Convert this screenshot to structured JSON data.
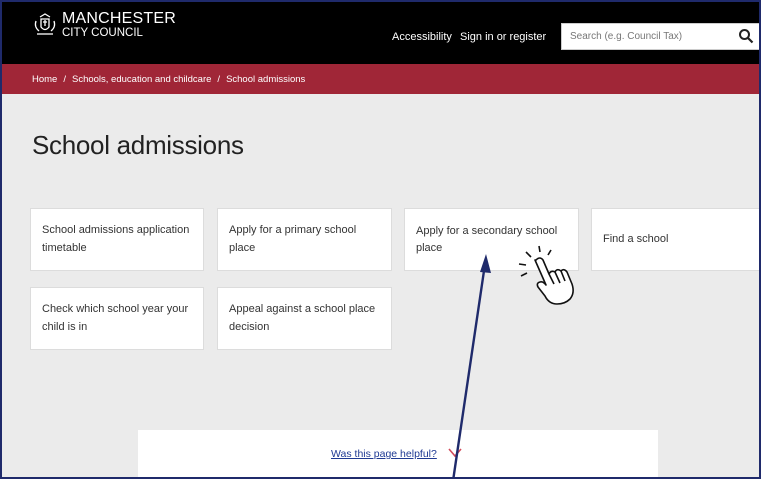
{
  "header": {
    "logo_line1": "MANCHESTER",
    "logo_line2": "CITY COUNCIL",
    "nav": {
      "accessibility": "Accessibility",
      "sign_in": "Sign in or register"
    },
    "search": {
      "placeholder": "Search (e.g. Council Tax)"
    }
  },
  "breadcrumb": {
    "items": [
      "Home",
      "Schools, education and childcare",
      "School admissions"
    ],
    "separator": "/"
  },
  "page": {
    "title": "School admissions"
  },
  "cards": [
    "School admissions application timetable",
    "Apply for a primary school place",
    "Apply for a secondary school place",
    "Find a school",
    "Check which school year your child is in",
    "Appeal against a school place decision"
  ],
  "feedback": {
    "label": "Was this page helpful?"
  },
  "colors": {
    "header_bg": "#000000",
    "breadcrumb_bg": "#a02637",
    "page_bg": "#ebebeb",
    "link": "#1f3a93",
    "annotation_arrow": "#1f2a6b",
    "chevron": "#d24b5a"
  },
  "icons": {
    "crest": "coat-of-arms-icon",
    "search": "magnifier-icon",
    "chevron": "chevron-down-icon",
    "pointer": "hand-pointer-icon"
  }
}
